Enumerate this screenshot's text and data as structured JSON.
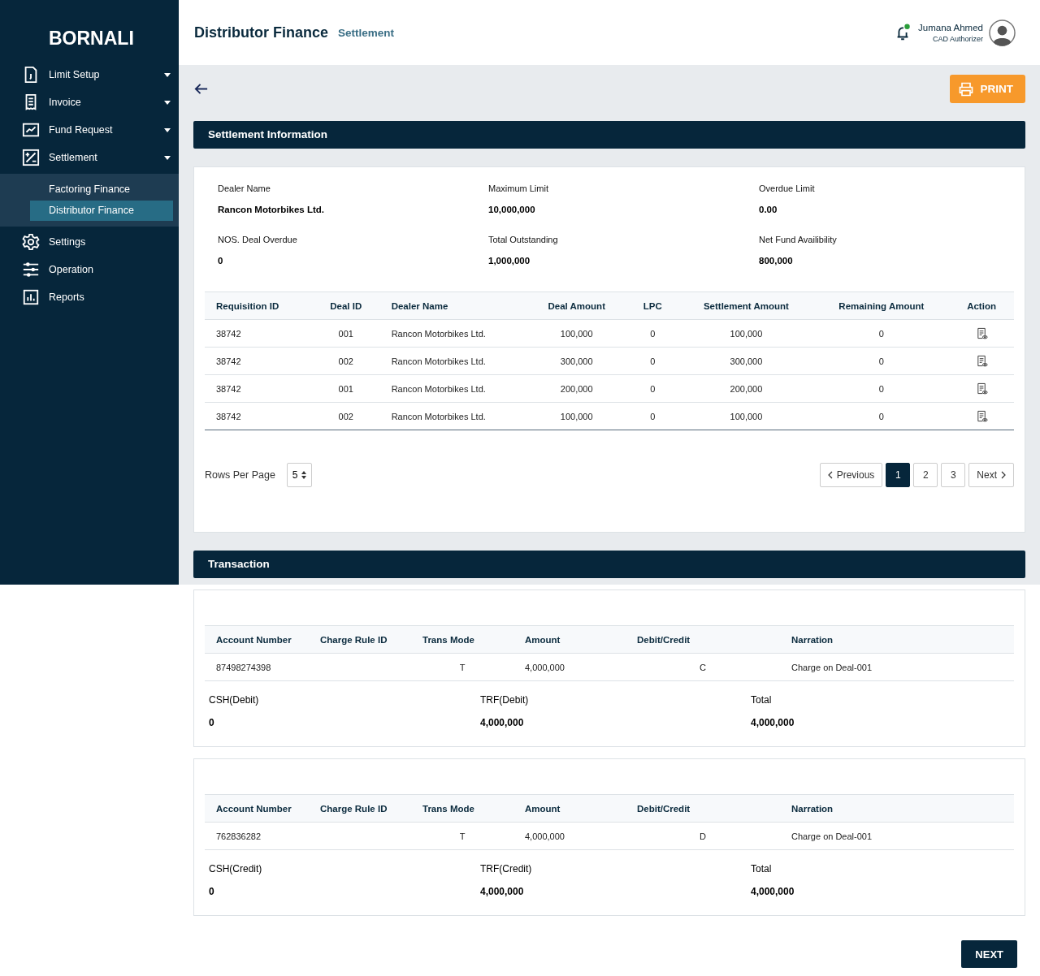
{
  "sidebar": {
    "brand": "BORNALI",
    "items": [
      {
        "label": "Limit Setup",
        "dropdown": true
      },
      {
        "label": "Invoice",
        "dropdown": true
      },
      {
        "label": "Fund Request",
        "dropdown": true
      },
      {
        "label": "Settlement",
        "dropdown": true,
        "children": [
          {
            "label": "Factoring Finance",
            "selected": false
          },
          {
            "label": "Distributor Finance",
            "selected": true
          }
        ]
      },
      {
        "label": "Settings",
        "dropdown": false
      },
      {
        "label": "Operation",
        "dropdown": false
      },
      {
        "label": "Reports",
        "dropdown": false
      }
    ]
  },
  "header": {
    "title": "Distributor Finance",
    "subtitle": "Settlement",
    "user": {
      "name": "Jumana Ahmed",
      "role": "CAD Authorizer"
    },
    "notification_dot": true
  },
  "toolbar": {
    "print": "PRINT"
  },
  "settlement": {
    "title": "Settlement Information",
    "fields": [
      {
        "label": "Dealer Name",
        "value": "Rancon Motorbikes Ltd."
      },
      {
        "label": "Maximum Limit",
        "value": "10,000,000"
      },
      {
        "label": "Overdue Limit",
        "value": "0.00"
      },
      {
        "label": "NOS. Deal Overdue",
        "value": "0"
      },
      {
        "label": "Total Outstanding",
        "value": "1,000,000"
      },
      {
        "label": "Net Fund Availibility",
        "value": "800,000"
      }
    ],
    "table": {
      "columns": [
        "Requisition ID",
        "Deal ID",
        "Dealer Name",
        "Deal Amount",
        "LPC",
        "Settlement Amount",
        "Remaining Amount",
        "Action"
      ],
      "rows": [
        [
          "38742",
          "001",
          "Rancon Motorbikes Ltd.",
          "100,000",
          "0",
          "100,000",
          "0"
        ],
        [
          "38742",
          "002",
          "Rancon Motorbikes Ltd.",
          "300,000",
          "0",
          "300,000",
          "0"
        ],
        [
          "38742",
          "001",
          "Rancon Motorbikes Ltd.",
          "200,000",
          "0",
          "200,000",
          "0"
        ],
        [
          "38742",
          "002",
          "Rancon Motorbikes Ltd.",
          "100,000",
          "0",
          "100,000",
          "0"
        ]
      ]
    },
    "rows_per_page": {
      "label": "Rows Per Page",
      "value": "5"
    },
    "pagination": {
      "previous": "Previous",
      "next": "Next",
      "pages": [
        {
          "label": "1",
          "selected": true
        },
        {
          "label": "2",
          "selected": false
        },
        {
          "label": "3",
          "selected": false
        }
      ]
    }
  },
  "transaction": {
    "title": "Transaction",
    "cards": [
      {
        "columns": [
          "Account Number",
          "Charge Rule ID",
          "Trans Mode",
          "Amount",
          "Debit/Credit",
          "Narration"
        ],
        "rows": [
          [
            "87498274398",
            "",
            "T",
            "4,000,000",
            "C",
            "Charge on Deal-001"
          ]
        ],
        "summary": [
          {
            "label": "CSH(Debit)",
            "value": "0"
          },
          {
            "label": "TRF(Debit)",
            "value": "4,000,000"
          },
          {
            "label": "Total",
            "value": "4,000,000"
          }
        ]
      },
      {
        "columns": [
          "Account Number",
          "Charge Rule ID",
          "Trans Mode",
          "Amount",
          "Debit/Credit",
          "Narration"
        ],
        "rows": [
          [
            "762836282",
            "",
            "T",
            "4,000,000",
            "D",
            "Charge on Deal-001"
          ]
        ],
        "summary": [
          {
            "label": "CSH(Credit)",
            "value": "0"
          },
          {
            "label": "TRF(Credit)",
            "value": "4,000,000"
          },
          {
            "label": "Total",
            "value": "4,000,000"
          }
        ]
      }
    ]
  },
  "next": "NEXT"
}
